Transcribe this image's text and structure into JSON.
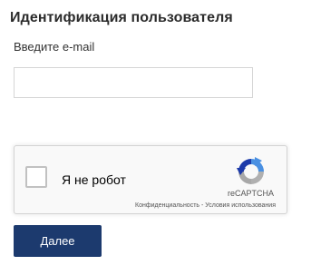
{
  "form": {
    "title": "Идентификация пользователя",
    "email_label": "Введите e-mail",
    "email_value": "",
    "email_placeholder": ""
  },
  "captcha": {
    "checkbox_label": "Я не робот",
    "brand": "reCAPTCHA",
    "privacy_link": "Конфиденциальность",
    "separator": " - ",
    "terms_link": "Условия использования",
    "logo_icon": "recaptcha-logo-icon",
    "colors": {
      "blue": "#4a90e2",
      "dark_blue": "#1c3aa9",
      "gray": "#b0b0b0"
    }
  },
  "actions": {
    "next_label": "Далее",
    "next_color": "#1c3a6e"
  }
}
